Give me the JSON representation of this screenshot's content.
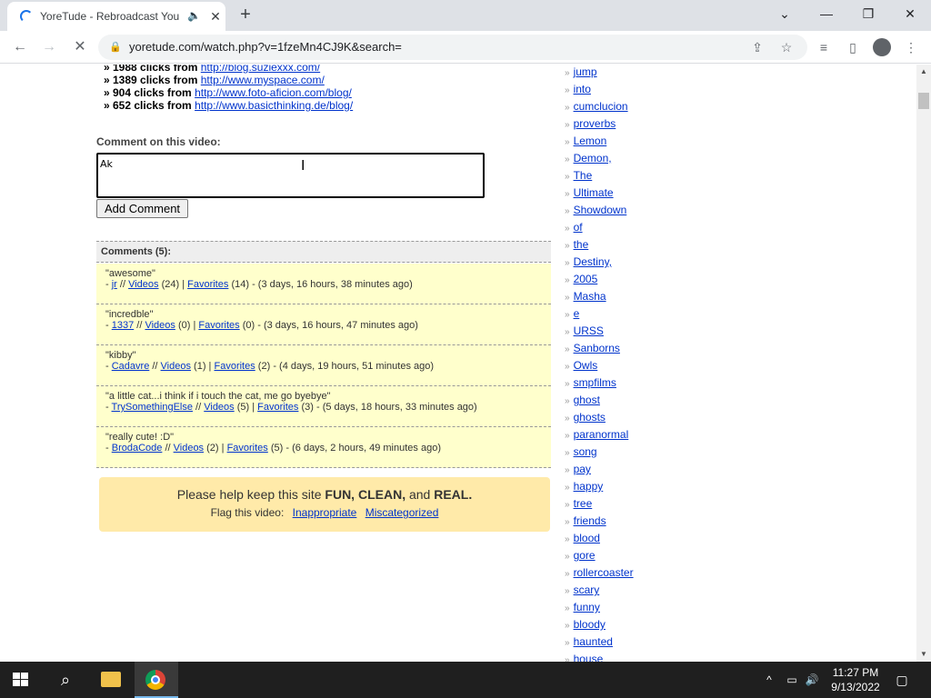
{
  "browser": {
    "tab_title": "YoreTude - Rebroadcast You",
    "new_tab": "+",
    "url": "yoretude.com/watch.php?v=1fzeMn4CJ9K&search="
  },
  "referrers": [
    {
      "count": "» 1988 clicks from",
      "url": "http://blog.suziexxx.com/"
    },
    {
      "count": "» 1389 clicks from",
      "url": "http://www.myspace.com/"
    },
    {
      "count": "» 904 clicks from",
      "url": "http://www.foto-aficion.com/blog/"
    },
    {
      "count": "» 652 clicks from",
      "url": "http://www.basicthinking.de/blog/"
    }
  ],
  "comment_form": {
    "label": "Comment on this video:",
    "value": "Ak",
    "button": "Add Comment"
  },
  "comments": {
    "header": "Comments (5):",
    "items": [
      {
        "text": "\"awesome\"",
        "user": "jr",
        "videos_label": "Videos",
        "videos_count": "(24)",
        "favorites_label": "Favorites",
        "favorites_count": "(14)",
        "time": "- (3 days, 16 hours, 38 minutes ago)"
      },
      {
        "text": "\"incredble\"",
        "user": "1337",
        "videos_label": "Videos",
        "videos_count": "(0)",
        "favorites_label": "Favorites",
        "favorites_count": "(0)",
        "time": "- (3 days, 16 hours, 47 minutes ago)"
      },
      {
        "text": "\"kibby\"",
        "user": "Cadavre",
        "videos_label": "Videos",
        "videos_count": "(1)",
        "favorites_label": "Favorites",
        "favorites_count": "(2)",
        "time": "- (4 days, 19 hours, 51 minutes ago)"
      },
      {
        "text": "\"a little cat...i think if i touch the cat, me go byebye\"",
        "user": "TrySomethingElse",
        "videos_label": "Videos",
        "videos_count": "(5)",
        "favorites_label": "Favorites",
        "favorites_count": "(3)",
        "time": "- (5 days, 18 hours, 33 minutes ago)"
      },
      {
        "text": "\"really cute! :D\"",
        "user": "BrodaCode",
        "videos_label": "Videos",
        "videos_count": "(2)",
        "favorites_label": "Favorites",
        "favorites_count": "(5)",
        "time": "- (6 days, 2 hours, 49 minutes ago)"
      }
    ]
  },
  "flag": {
    "line1_pre": "Please help keep this site",
    "fun": "FUN,",
    "clean": "CLEAN,",
    "and": "and",
    "real": "REAL.",
    "line2_label": "Flag this video:",
    "inappropriate": "Inappropriate",
    "miscategorized": "Miscategorized"
  },
  "tags": [
    "jump",
    "into",
    "cumclucion",
    "proverbs",
    "Lemon",
    "Demon,",
    "The",
    "Ultimate",
    "Showdown",
    "of",
    "the",
    "Destiny,",
    "2005",
    "Masha",
    "e",
    "URSS",
    "Sanborns",
    "Owls",
    "smpfilms",
    "ghost",
    "ghosts",
    "paranormal",
    "song",
    "pay",
    "happy",
    "tree",
    "friends",
    "blood",
    "gore",
    "rollercoaster",
    "scary",
    "funny",
    "bloody",
    "haunted",
    "house"
  ],
  "taskbar": {
    "time": "11:27 PM",
    "date": "9/13/2022"
  },
  "colors": {
    "link": "#0033cc",
    "comment_bg": "#ffffcc",
    "flag_bg": "#ffeaa9",
    "taskbar_bg": "#1f1f1f"
  }
}
